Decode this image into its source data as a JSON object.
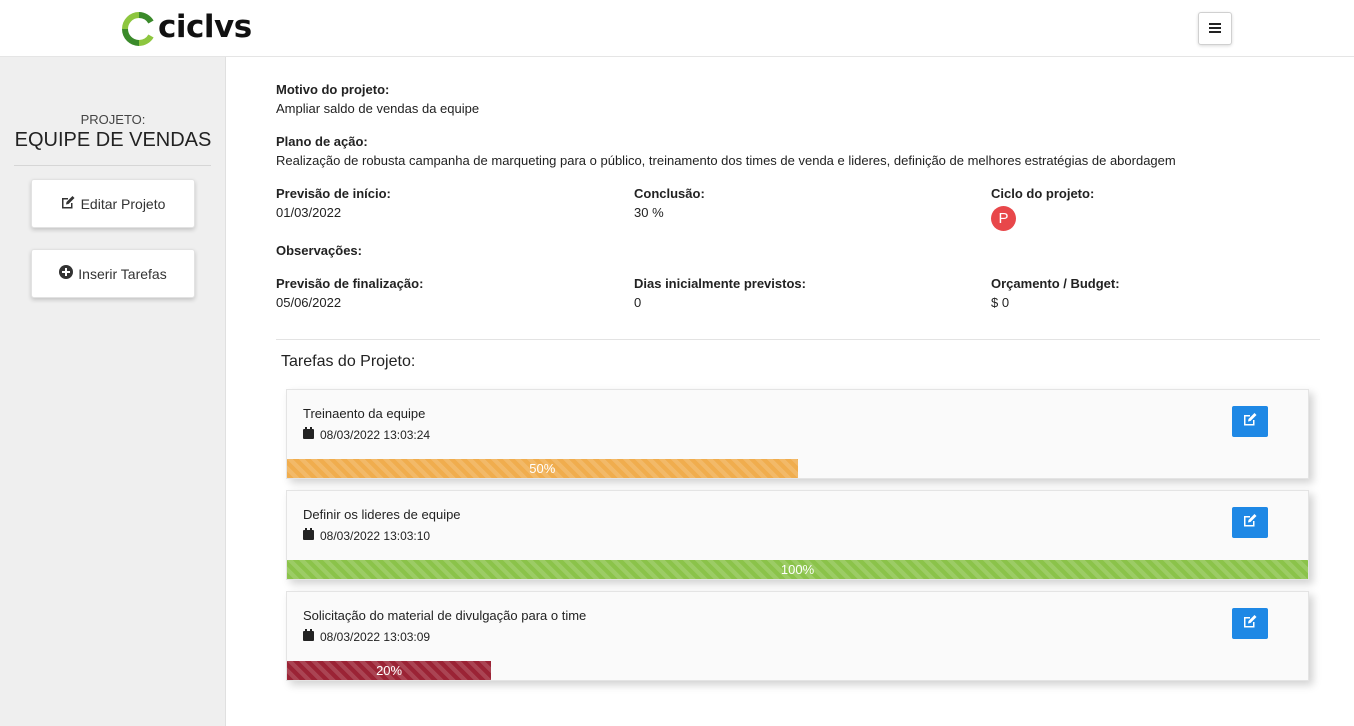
{
  "header": {
    "logo_text": "ciclvs",
    "logo_colors": {
      "green": "#8dc63f",
      "dark": "#3a8a2a"
    }
  },
  "sidebar": {
    "project_label": "PROJETO:",
    "project_name": "EQUIPE DE VENDAS",
    "edit_button": "Editar Projeto",
    "insert_button": "Inserir Tarefas"
  },
  "details": {
    "motivo_label": "Motivo do projeto:",
    "motivo_value": "Ampliar saldo de vendas da equipe",
    "plano_label": "Plano de ação:",
    "plano_value": "Realização de robusta campanha de marqueting para o público, treinamento dos times de venda e lideres, definição de melhores estratégias de abordagem",
    "inicio_label": "Previsão de início:",
    "inicio_value": "01/03/2022",
    "conclusao_label": "Conclusão:",
    "conclusao_value": "30 %",
    "ciclo_label": "Ciclo do projeto:",
    "ciclo_value": "P",
    "observacoes_label": "Observações:",
    "finalizacao_label": "Previsão de finalização:",
    "finalizacao_value": "05/06/2022",
    "dias_label": "Dias inicialmente previstos:",
    "dias_value": "0",
    "orcamento_label": "Orçamento / Budget:",
    "orcamento_value": "$ 0"
  },
  "tasks_title": "Tarefas do Projeto:",
  "tasks": [
    {
      "title": "Treinaento da equipe",
      "date": "08/03/2022 13:03:24",
      "progress": 50,
      "progress_label": "50%",
      "color": "#f0ad4e"
    },
    {
      "title": "Definir os lideres de equipe",
      "date": "08/03/2022 13:03:10",
      "progress": 100,
      "progress_label": "100%",
      "color": "#8bc34a"
    },
    {
      "title": "Solicitação do material de divulgação para o time",
      "date": "08/03/2022 13:03:09",
      "progress": 20,
      "progress_label": "20%",
      "color": "#9b2335"
    }
  ],
  "icons": {
    "menu": "hamburger-icon",
    "edit": "edit-icon",
    "add": "plus-circle-icon",
    "calendar": "calendar-icon"
  }
}
